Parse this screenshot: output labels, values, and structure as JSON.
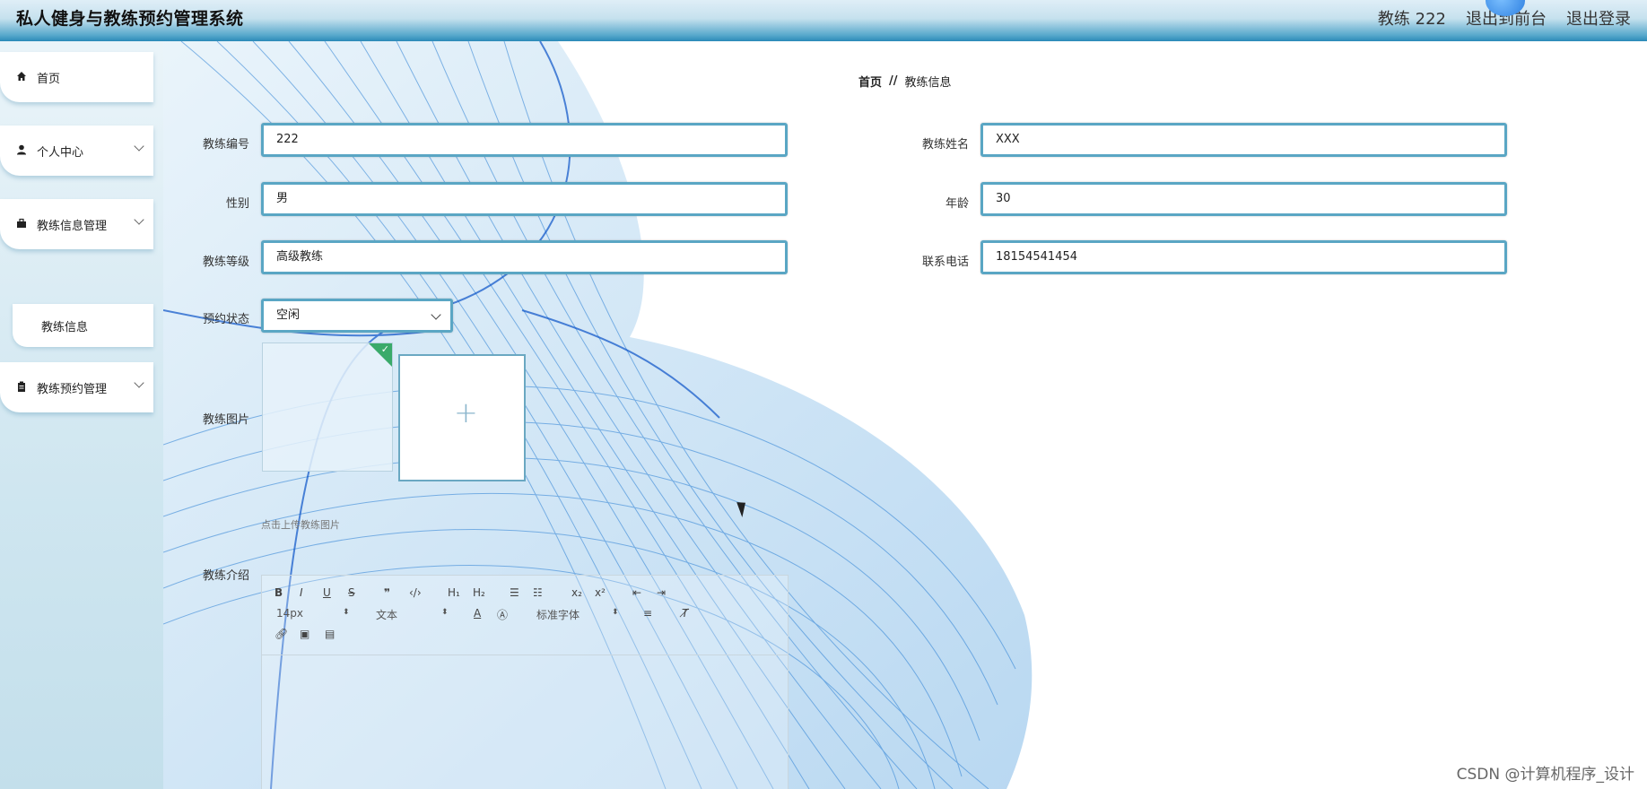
{
  "header": {
    "app_title": "私人健身与教练预约管理系统",
    "user_label": "教练 222",
    "front_label": "退出到前台",
    "logout_label": "退出登录"
  },
  "sidebar": {
    "items": [
      {
        "label": "首页",
        "icon": "home-icon"
      },
      {
        "label": "个人中心",
        "icon": "user-icon"
      },
      {
        "label": "教练信息管理",
        "icon": "briefcase-icon"
      },
      {
        "label": "教练预约管理",
        "icon": "clipboard-icon"
      }
    ],
    "sub_item": "教练信息"
  },
  "breadcrumb": {
    "home": "首页",
    "separator": "//",
    "current": "教练信息"
  },
  "form": {
    "coach_no_label": "教练编号",
    "coach_no_value": "222",
    "coach_name_label": "教练姓名",
    "coach_name_value": "XXX",
    "gender_label": "性别",
    "gender_value": "男",
    "age_label": "年龄",
    "age_value": "30",
    "level_label": "教练等级",
    "level_value": "高级教练",
    "phone_label": "联系电话",
    "phone_value": "18154541454",
    "status_label": "预约状态",
    "status_value": "空闲",
    "image_label": "教练图片",
    "upload_tip": "点击上传教练图片",
    "intro_label": "教练介绍"
  },
  "editor": {
    "font_size": "14px",
    "block_type": "文本",
    "font_family": "标准字体"
  },
  "watermark": "CSDN @计算机程序_设计",
  "colors": {
    "accent": "#5aa6c4",
    "header_dark": "#2b8ab8",
    "badge_green": "#3aaa6a"
  }
}
